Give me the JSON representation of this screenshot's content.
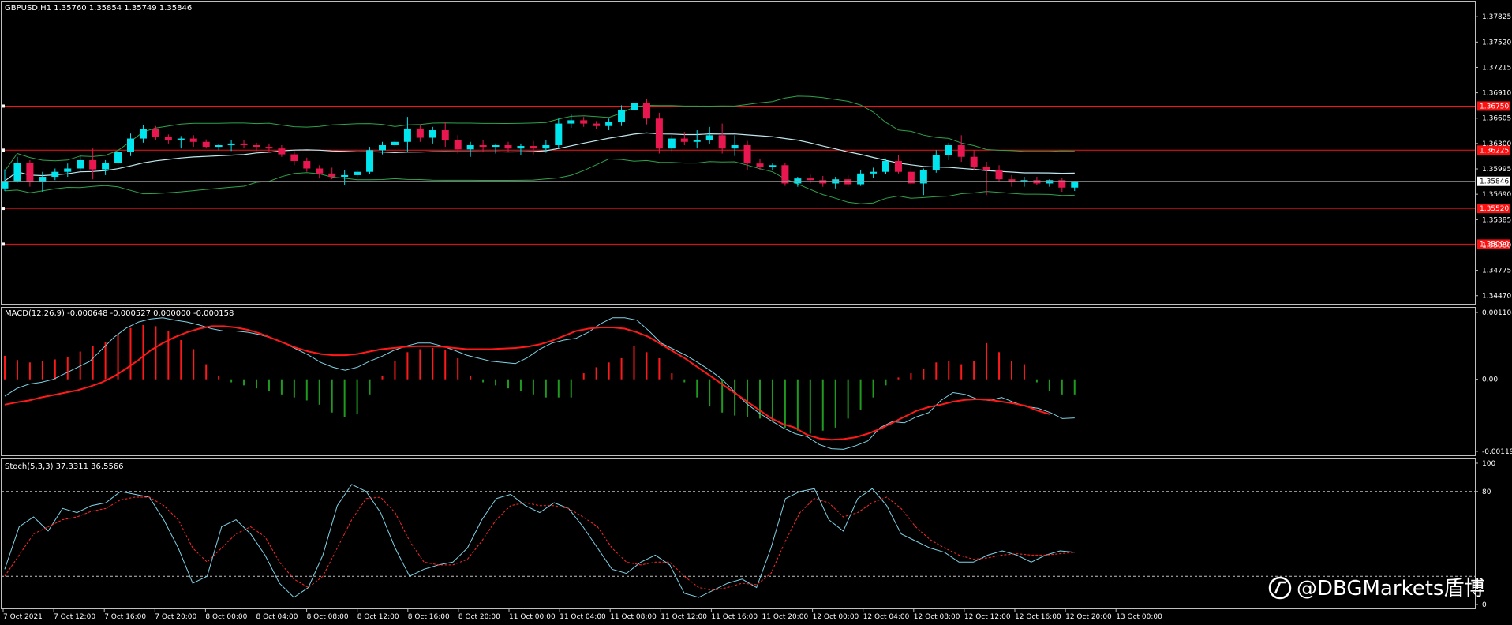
{
  "symbol_header": "GBPUSD,H1  1.35760 1.35854 1.35749 1.35846",
  "watermark": "@DBGMarkets盾博",
  "colors": {
    "background": "#000000",
    "bull": "#00e5ee",
    "bear": "#e8174f",
    "band": "#2fa24a",
    "ma": "#bfe8ee",
    "level_line": "#ff1010",
    "macd_pos": "#ff1a1a",
    "macd_neg": "#1f9a1f",
    "signal": "#ff1a1a",
    "stoch_main": "#7fd3e6",
    "stoch_signal": "#ff2a2a",
    "grid_text": "#ffffff"
  },
  "time_axis": [
    "7 Oct 2021",
    "7 Oct 12:00",
    "7 Oct 16:00",
    "7 Oct 20:00",
    "8 Oct 00:00",
    "8 Oct 04:00",
    "8 Oct 08:00",
    "8 Oct 12:00",
    "8 Oct 16:00",
    "8 Oct 20:00",
    "11 Oct 00:00",
    "11 Oct 04:00",
    "11 Oct 08:00",
    "11 Oct 12:00",
    "11 Oct 16:00",
    "11 Oct 20:00",
    "12 Oct 00:00",
    "12 Oct 04:00",
    "12 Oct 08:00",
    "12 Oct 12:00",
    "12 Oct 16:00",
    "12 Oct 20:00",
    "13 Oct 00:00"
  ],
  "chart_data": [
    {
      "type": "candlestick",
      "name": "price",
      "ylim": [
        1.3442,
        1.3795
      ],
      "y_ticks": [
        "1.37825",
        "1.37520",
        "1.37215",
        "1.36910",
        "1.36605",
        "1.36300",
        "1.35995",
        "1.35690",
        "1.35385",
        "1.35080",
        "1.34775",
        "1.34470"
      ],
      "current_price": "1.35846",
      "levels": [
        {
          "label": "1.36750",
          "value": 1.3675
        },
        {
          "label": "1.36225",
          "value": 1.3622
        },
        {
          "label": "1.35520",
          "value": 1.3552
        },
        {
          "label": "1.35090",
          "value": 1.3509
        }
      ],
      "ohlc": [
        [
          1.3576,
          1.3599,
          1.3573,
          1.3585
        ],
        [
          1.3585,
          1.3614,
          1.3583,
          1.3607
        ],
        [
          1.3607,
          1.361,
          1.3578,
          1.3584
        ],
        [
          1.3584,
          1.3596,
          1.3572,
          1.359
        ],
        [
          1.359,
          1.36,
          1.3586,
          1.3596
        ],
        [
          1.3596,
          1.3606,
          1.359,
          1.36
        ],
        [
          1.36,
          1.3616,
          1.3597,
          1.361
        ],
        [
          1.361,
          1.3624,
          1.3587,
          1.3599
        ],
        [
          1.3599,
          1.361,
          1.3592,
          1.3607
        ],
        [
          1.3607,
          1.3624,
          1.3601,
          1.362
        ],
        [
          1.362,
          1.3642,
          1.3615,
          1.3636
        ],
        [
          1.3636,
          1.3652,
          1.3631,
          1.3647
        ],
        [
          1.3647,
          1.3651,
          1.3634,
          1.3638
        ],
        [
          1.3638,
          1.3641,
          1.363,
          1.3634
        ],
        [
          1.3634,
          1.3639,
          1.3624,
          1.3636
        ],
        [
          1.3636,
          1.364,
          1.3626,
          1.3632
        ],
        [
          1.3632,
          1.3635,
          1.3624,
          1.3626
        ],
        [
          1.3626,
          1.3629,
          1.3622,
          1.3628
        ],
        [
          1.3628,
          1.3634,
          1.3621,
          1.363
        ],
        [
          1.363,
          1.3634,
          1.3624,
          1.3628
        ],
        [
          1.3628,
          1.3631,
          1.3621,
          1.3626
        ],
        [
          1.3626,
          1.363,
          1.3619,
          1.3624
        ],
        [
          1.3624,
          1.3628,
          1.3614,
          1.3617
        ],
        [
          1.3617,
          1.3621,
          1.3604,
          1.3609
        ],
        [
          1.3609,
          1.3613,
          1.3596,
          1.36
        ],
        [
          1.36,
          1.3604,
          1.3588,
          1.3594
        ],
        [
          1.3594,
          1.3601,
          1.3587,
          1.359
        ],
        [
          1.359,
          1.3598,
          1.358,
          1.3592
        ],
        [
          1.3592,
          1.3598,
          1.3589,
          1.3596
        ],
        [
          1.3596,
          1.3626,
          1.3593,
          1.3622
        ],
        [
          1.3622,
          1.3632,
          1.3617,
          1.3628
        ],
        [
          1.3628,
          1.3636,
          1.3624,
          1.3632
        ],
        [
          1.3632,
          1.3662,
          1.362,
          1.3648
        ],
        [
          1.3648,
          1.3653,
          1.3632,
          1.3637
        ],
        [
          1.3637,
          1.365,
          1.363,
          1.3646
        ],
        [
          1.3646,
          1.3656,
          1.3626,
          1.3634
        ],
        [
          1.3634,
          1.364,
          1.3618,
          1.3623
        ],
        [
          1.3623,
          1.3632,
          1.3614,
          1.3628
        ],
        [
          1.3628,
          1.3634,
          1.362,
          1.3626
        ],
        [
          1.3626,
          1.363,
          1.3618,
          1.3628
        ],
        [
          1.3628,
          1.3632,
          1.362,
          1.3624
        ],
        [
          1.3624,
          1.363,
          1.3616,
          1.3627
        ],
        [
          1.3627,
          1.3633,
          1.3617,
          1.3624
        ],
        [
          1.3624,
          1.3634,
          1.3619,
          1.3628
        ],
        [
          1.3628,
          1.366,
          1.3625,
          1.3654
        ],
        [
          1.3654,
          1.3665,
          1.3649,
          1.3658
        ],
        [
          1.3658,
          1.3662,
          1.365,
          1.3654
        ],
        [
          1.3654,
          1.3657,
          1.3647,
          1.3651
        ],
        [
          1.3651,
          1.366,
          1.3646,
          1.3656
        ],
        [
          1.3656,
          1.3676,
          1.3651,
          1.367
        ],
        [
          1.367,
          1.3682,
          1.3664,
          1.3679
        ],
        [
          1.3679,
          1.3684,
          1.3653,
          1.366
        ],
        [
          1.366,
          1.3667,
          1.3618,
          1.3624
        ],
        [
          1.3624,
          1.364,
          1.3619,
          1.3636
        ],
        [
          1.3636,
          1.3644,
          1.3628,
          1.3632
        ],
        [
          1.3632,
          1.3646,
          1.3624,
          1.3634
        ],
        [
          1.3634,
          1.365,
          1.363,
          1.364
        ],
        [
          1.364,
          1.3654,
          1.3618,
          1.3624
        ],
        [
          1.3624,
          1.364,
          1.3615,
          1.3628
        ],
        [
          1.3628,
          1.3633,
          1.3598,
          1.3606
        ],
        [
          1.3606,
          1.3612,
          1.3598,
          1.3602
        ],
        [
          1.3602,
          1.3606,
          1.3598,
          1.3604
        ],
        [
          1.3604,
          1.3607,
          1.3579,
          1.3582
        ],
        [
          1.3582,
          1.359,
          1.3578,
          1.3588
        ],
        [
          1.3588,
          1.3593,
          1.3582,
          1.3586
        ],
        [
          1.3586,
          1.3591,
          1.3578,
          1.3582
        ],
        [
          1.3582,
          1.359,
          1.3576,
          1.3587
        ],
        [
          1.3587,
          1.3592,
          1.3578,
          1.3581
        ],
        [
          1.3581,
          1.3598,
          1.3579,
          1.3594
        ],
        [
          1.3594,
          1.3601,
          1.3589,
          1.3596
        ],
        [
          1.3596,
          1.3612,
          1.3593,
          1.3609
        ],
        [
          1.3609,
          1.3616,
          1.3594,
          1.3596
        ],
        [
          1.3596,
          1.3612,
          1.3579,
          1.3582
        ],
        [
          1.3582,
          1.36,
          1.3568,
          1.3598
        ],
        [
          1.3598,
          1.3622,
          1.3595,
          1.3616
        ],
        [
          1.3616,
          1.3631,
          1.361,
          1.3628
        ],
        [
          1.3628,
          1.364,
          1.3608,
          1.3614
        ],
        [
          1.3614,
          1.3622,
          1.3598,
          1.3602
        ],
        [
          1.3602,
          1.3608,
          1.3568,
          1.3598
        ],
        [
          1.3598,
          1.3604,
          1.3584,
          1.3587
        ],
        [
          1.3587,
          1.3592,
          1.3578,
          1.3584
        ],
        [
          1.3584,
          1.359,
          1.3578,
          1.3586
        ],
        [
          1.3586,
          1.359,
          1.358,
          1.3582
        ],
        [
          1.3582,
          1.3587,
          1.3578,
          1.3586
        ],
        [
          1.3586,
          1.3589,
          1.3572,
          1.3577
        ],
        [
          1.3577,
          1.3585,
          1.3573,
          1.3585
        ]
      ]
    },
    {
      "type": "bar+line",
      "name": "MACD",
      "header": "MACD(12,26,9) -0.000648 -0.000527 0.000000 -0.000158",
      "ylim": [
        -0.001194,
        0.001108
      ],
      "y_ticks": [
        "0.001108",
        "0.00",
        "-0.001194"
      ],
      "histogram": [
        0.00039,
        0.00032,
        0.00028,
        0.0003,
        0.00033,
        0.00037,
        0.00046,
        0.00055,
        0.00062,
        0.00075,
        0.00085,
        0.0009,
        0.00088,
        0.0008,
        0.00065,
        0.0005,
        0.00025,
        5e-05,
        -5e-05,
        -0.0001,
        -0.00015,
        -0.0002,
        -0.00025,
        -0.0003,
        -0.00035,
        -0.00042,
        -0.00055,
        -0.00062,
        -0.00058,
        -0.00025,
        5e-05,
        0.0003,
        0.00045,
        0.0005,
        0.00052,
        0.00048,
        0.00035,
        5e-05,
        -5e-05,
        -0.0001,
        -0.00015,
        -0.0002,
        -0.00025,
        -0.0003,
        -0.0003,
        -0.0003,
        0.0001,
        0.0002,
        0.00028,
        0.00035,
        0.00055,
        0.00045,
        0.00035,
        0.0001,
        -5e-05,
        -0.0003,
        -0.00045,
        -0.00055,
        -0.0006,
        -0.00062,
        -0.00065,
        -0.0007,
        -0.0008,
        -0.00085,
        -0.0009,
        -0.00085,
        -0.0008,
        -0.00065,
        -0.0005,
        -0.0003,
        -0.0001,
        3e-05,
        0.0001,
        0.00018,
        0.00028,
        0.0003,
        0.00025,
        0.0003,
        0.0006,
        0.00045,
        0.0003,
        0.00025,
        -5e-05,
        -0.0002,
        -0.00025,
        -0.00025
      ],
      "macd": [
        -0.00028,
        -0.00015,
        -8e-05,
        -5e-05,
        0.0,
        0.0001,
        0.0002,
        0.0003,
        0.0005,
        0.0007,
        0.00085,
        0.00095,
        0.001,
        0.00102,
        0.00098,
        0.00095,
        0.0009,
        0.00084,
        0.0008,
        0.0008,
        0.00078,
        0.00074,
        0.00068,
        0.0006,
        0.0005,
        0.0004,
        0.00028,
        0.0002,
        0.00015,
        0.0002,
        0.0003,
        0.00038,
        0.00048,
        0.00055,
        0.0006,
        0.0006,
        0.00055,
        0.00048,
        0.0004,
        0.00035,
        0.0003,
        0.00028,
        0.00026,
        0.00036,
        0.0005,
        0.0006,
        0.00065,
        0.00068,
        0.00078,
        0.00092,
        0.00102,
        0.00102,
        0.00098,
        0.0008,
        0.0006,
        0.0005,
        0.0004,
        0.00028,
        0.00015,
        0.0,
        -0.0002,
        -0.0004,
        -0.00055,
        -0.00068,
        -0.0008,
        -0.0009,
        -0.00095,
        -0.00108,
        -0.00115,
        -0.00116,
        -0.0011,
        -0.00102,
        -0.0008,
        -0.0007,
        -0.00072,
        -0.00062,
        -0.00055,
        -0.00035,
        -0.00022,
        -0.00025,
        -0.00033,
        -0.00035,
        -0.0003,
        -0.00038,
        -0.00045,
        -0.00048,
        -0.00055,
        -0.00065,
        -0.00064
      ],
      "signal": [
        -0.00042,
        -0.00038,
        -0.00035,
        -0.0003,
        -0.00026,
        -0.00022,
        -0.00018,
        -0.00012,
        -5e-05,
        5e-05,
        0.00018,
        0.00032,
        0.00048,
        0.0006,
        0.0007,
        0.00078,
        0.00084,
        0.00088,
        0.00088,
        0.00086,
        0.00082,
        0.00076,
        0.00068,
        0.0006,
        0.00052,
        0.00046,
        0.00042,
        0.0004,
        0.0004,
        0.00042,
        0.00046,
        0.0005,
        0.00052,
        0.00054,
        0.00055,
        0.00055,
        0.00054,
        0.00052,
        0.0005,
        0.0005,
        0.0005,
        0.00051,
        0.00052,
        0.00054,
        0.00058,
        0.00064,
        0.00072,
        0.0008,
        0.00084,
        0.00086,
        0.00086,
        0.00084,
        0.00078,
        0.0007,
        0.00058,
        0.00046,
        0.00034,
        0.0002,
        6e-05,
        -8e-05,
        -0.00022,
        -0.00036,
        -0.0005,
        -0.00064,
        -0.00074,
        -0.0008,
        -0.00092,
        -0.00098,
        -0.001,
        -0.00099,
        -0.00096,
        -0.0009,
        -0.00082,
        -0.00072,
        -0.00062,
        -0.00052,
        -0.00046,
        -0.00042,
        -0.00037,
        -0.00034,
        -0.00033,
        -0.00034,
        -0.00037,
        -0.0004,
        -0.00044,
        -0.00052,
        -0.00058
      ],
      "n_macd": 86
    },
    {
      "type": "line",
      "name": "Stoch",
      "header": "Stoch(5,3,3) 37.3311 36.5566",
      "ylim": [
        0,
        100
      ],
      "y_ticks": [
        "100",
        "80",
        "0"
      ],
      "levels": [
        80,
        20
      ],
      "main": [
        25,
        55,
        62,
        52,
        68,
        65,
        70,
        72,
        80,
        78,
        76,
        60,
        40,
        15,
        20,
        55,
        60,
        50,
        35,
        15,
        5,
        12,
        35,
        70,
        85,
        80,
        65,
        40,
        20,
        25,
        28,
        30,
        40,
        60,
        75,
        78,
        70,
        65,
        72,
        68,
        55,
        40,
        25,
        22,
        30,
        35,
        28,
        8,
        5,
        10,
        15,
        18,
        12,
        40,
        75,
        80,
        82,
        60,
        52,
        75,
        82,
        70,
        50,
        45,
        40,
        37,
        30,
        30,
        35,
        38,
        35,
        30,
        35,
        38,
        37
      ],
      "signal": [
        20,
        35,
        50,
        55,
        60,
        62,
        66,
        68,
        74,
        76,
        76,
        70,
        60,
        40,
        30,
        40,
        50,
        55,
        48,
        30,
        18,
        12,
        20,
        40,
        60,
        75,
        76,
        65,
        45,
        30,
        28,
        28,
        32,
        45,
        60,
        70,
        72,
        70,
        70,
        68,
        62,
        55,
        40,
        30,
        28,
        30,
        30,
        20,
        12,
        10,
        12,
        15,
        14,
        22,
        45,
        65,
        75,
        72,
        62,
        65,
        72,
        76,
        68,
        55,
        46,
        40,
        35,
        32,
        33,
        35,
        36,
        35,
        35,
        36,
        37
      ]
    }
  ]
}
